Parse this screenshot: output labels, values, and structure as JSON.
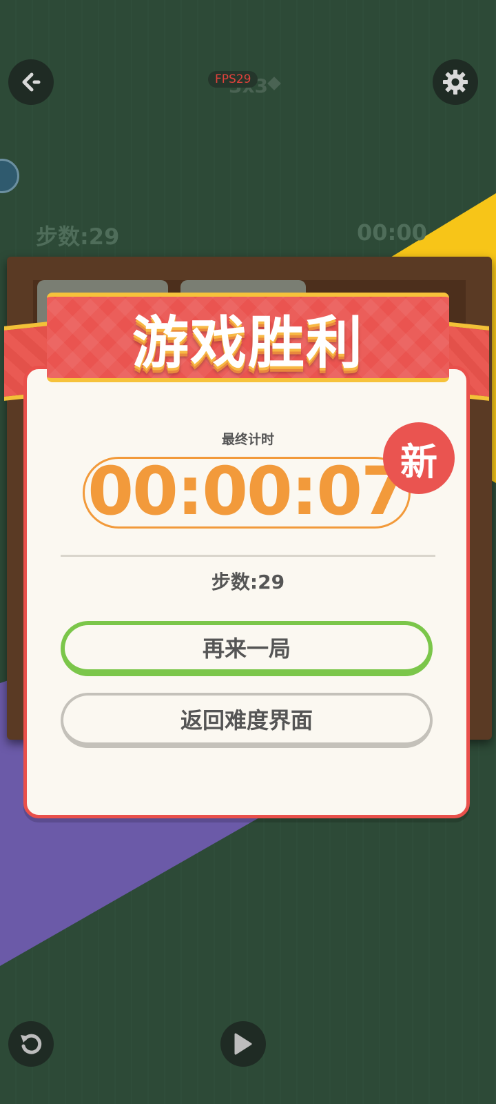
{
  "hud": {
    "fps_label": "FPS29",
    "level_label": "3x3",
    "steps_label": "步数:29",
    "timer_label": "00:00"
  },
  "dialog": {
    "title": "游戏胜利",
    "final_time_label": "最终计时",
    "final_time": "00:00:07",
    "new_badge": "新",
    "steps": "步数:29",
    "play_again": "再来一局",
    "back_to_difficulty": "返回难度界面"
  },
  "icons": {
    "back": "back-arrow-icon",
    "settings": "gear-icon",
    "restart": "restart-icon",
    "play": "play-icon"
  },
  "colors": {
    "background": "#2d4a37",
    "accent_red": "#ea5450",
    "accent_yellow": "#f6c23b",
    "timer_orange": "#f29a3b",
    "green_button": "#7bc64a",
    "purple_bg": "#6b5aa8",
    "yellow_bg": "#f7c518"
  }
}
